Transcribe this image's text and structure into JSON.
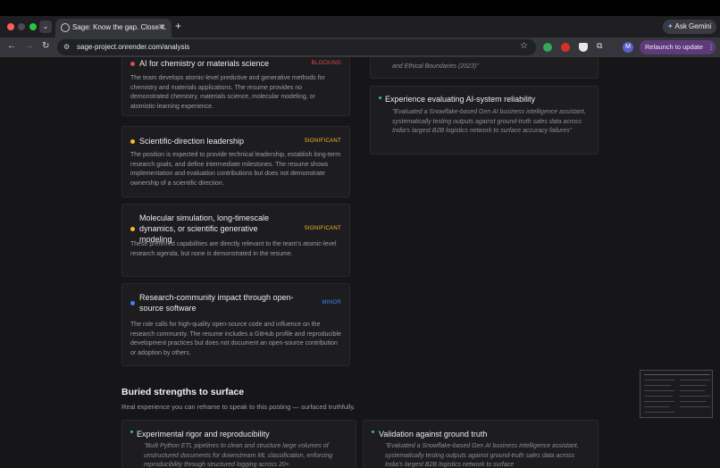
{
  "browser": {
    "tab_title": "Sage: Know the gap. Close it.",
    "tab_close": "✕",
    "new_tab": "+",
    "ask_gemini": "Ask Gemini",
    "url": "sage-project.onrender.com/analysis",
    "profile_initial": "M",
    "relaunch": "Relaunch to update",
    "colors": {
      "relaunch_bg": "#5e3a78",
      "close": "#ff5f57",
      "minimize": "#4a4a4f",
      "maximize": "#28c840"
    }
  },
  "gaps": [
    {
      "title": "AI for chemistry or materials science",
      "severity": "BLOCKING",
      "color": "#e5484d",
      "description": "The team develops atomic-level predictive and generative methods for chemistry and materials applications. The resume provides no demonstrated chemistry, materials science, molecular modeling, or atomistic-learning experience."
    },
    {
      "title": "Scientific-direction leadership",
      "severity": "SIGNIFICANT",
      "color": "#f5b829",
      "description": "The position is expected to provide technical leadership, establish long-term research goals, and define intermediate milestones. The resume shows implementation and evaluation contributions but does not demonstrate ownership of a scientific direction."
    },
    {
      "title": "Molecular simulation, long-timescale dynamics, or scientific generative modeling",
      "severity": "SIGNIFICANT",
      "color": "#f5b829",
      "description": "These preferred capabilities are directly relevant to the team's atomic-level research agenda, but none is demonstrated in the resume."
    },
    {
      "title": "Research-community impact through open-source software",
      "severity": "MINOR",
      "color": "#3b82f6",
      "description": "The role calls for high-quality open-source code and influence on the research community. The resume includes a GitHub profile and reproducible development practices but does not document an open-source contribution or adoption by others."
    }
  ],
  "right_column": {
    "partial_quote": "and Ethical Boundaries (2023)\"",
    "experience_title": "Experience evaluating AI-system reliability",
    "experience_quote": "\"Evaluated a Snowflake-based Gen AI business intelligence assistant, systematically testing outputs against ground-truth sales data across India's largest B2B logistics network to surface accuracy failures\""
  },
  "strengths_section": {
    "title": "Buried strengths to surface",
    "subtitle": "Real experience you can reframe to speak to this posting — surfaced truthfully."
  },
  "strengths": [
    {
      "title": "Experimental rigor and reproducibility",
      "quote": "\"Built Python ETL pipelines to clean and structure large volumes of unstructured documents for downstream ML classification, enforcing reproducibility through structured logging across 20+"
    },
    {
      "title": "Validation against ground truth",
      "quote": "\"Evaluated a Snowflake-based Gen AI business intelligence assistant, systematically testing outputs against ground-truth sales data across India's largest B2B logistics network to surface"
    }
  ]
}
